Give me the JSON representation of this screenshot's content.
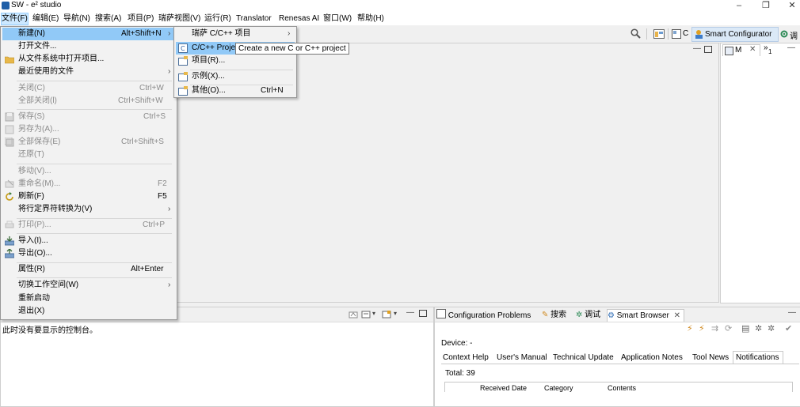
{
  "window": {
    "title": "SW - e² studio",
    "minimize": "–",
    "restore": "❐",
    "close": "✕"
  },
  "menubar": [
    "文件(F)",
    "编辑(E)",
    "导航(N)",
    "搜索(A)",
    "项目(P)",
    "瑞萨视图(V)",
    "运行(R)",
    "Translator",
    "Renesas AI",
    "窗口(W)",
    "帮助(H)"
  ],
  "toolbar": {
    "c_label": "C",
    "smart_configurator": "Smart Configurator",
    "debug_label": "调"
  },
  "file_menu": {
    "new": {
      "label": "新建(N)",
      "shortcut": "Alt+Shift+N"
    },
    "open_file": "打开文件...",
    "open_from_fs": "从文件系统中打开项目...",
    "recent": "最近使用的文件",
    "close": {
      "label": "关闭(C)",
      "shortcut": "Ctrl+W"
    },
    "close_all": {
      "label": "全部关闭(l)",
      "shortcut": "Ctrl+Shift+W"
    },
    "save": {
      "label": "保存(S)",
      "shortcut": "Ctrl+S"
    },
    "save_as": "另存为(A)...",
    "save_all": {
      "label": "全部保存(E)",
      "shortcut": "Ctrl+Shift+S"
    },
    "revert": "还原(T)",
    "move": "移动(V)...",
    "rename": {
      "label": "重命名(M)...",
      "shortcut": "F2"
    },
    "refresh": {
      "label": "刷新(F)",
      "shortcut": "F5"
    },
    "convert_line": "将行定界符转换为(V)",
    "print": {
      "label": "打印(P)...",
      "shortcut": "Ctrl+P"
    },
    "import": "导入(I)...",
    "export": "导出(O)...",
    "properties": {
      "label": "属性(R)",
      "shortcut": "Alt+Enter"
    },
    "switch_ws": "切换工作空间(W)",
    "restart": "重新启动",
    "exit": "退出(X)"
  },
  "new_submenu": {
    "renesas": "瑞萨 C/C++ 项目",
    "cproject": "C/C++ Proje",
    "project": "项目(R)...",
    "example": "示例(X)...",
    "other": {
      "label": "其他(O)...",
      "shortcut": "Ctrl+N"
    }
  },
  "tooltip": "Create a new C or C++ project",
  "right_view": {
    "tab": "M",
    "more": "»",
    "more_count": "1"
  },
  "console": {
    "empty_message": "此时没有要显示的控制台。"
  },
  "bottom_tabs": {
    "config_problems": "Configuration Problems",
    "search": "搜索",
    "debug": "调试",
    "smart_browser": "Smart Browser"
  },
  "smart_browser": {
    "device": "Device: -",
    "subtabs": [
      "Context Help",
      "User's Manual",
      "Technical Update",
      "Application Notes",
      "Tool News",
      "Notifications"
    ],
    "total": "Total: 39",
    "columns": [
      "Received Date",
      "Category",
      "Contents"
    ]
  },
  "colors": {
    "highlight": "#91c9f7",
    "menu_bg": "#f2f2f2",
    "accent": "#0078d7"
  }
}
